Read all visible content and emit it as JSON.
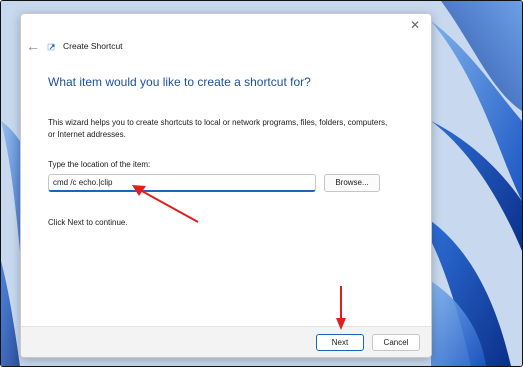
{
  "dialog": {
    "title": "Create Shortcut",
    "close_glyph": "✕",
    "back_glyph": "←",
    "heading": "What item would you like to create a shortcut for?",
    "description": "This wizard helps you to create shortcuts to local or network programs, files, folders, computers, or Internet addresses.",
    "location_label": "Type the location of the item:",
    "location_value": "cmd /c echo.|clip",
    "browse_label": "Browse...",
    "continue_text": "Click Next to continue.",
    "next_label": "Next",
    "cancel_label": "Cancel"
  },
  "icons": {
    "back": "back-arrow-icon",
    "close": "close-icon",
    "app": "shortcut-app-icon"
  },
  "colors": {
    "heading": "#1e4f9c",
    "accent": "#1f64b6",
    "annotation_arrow": "#e0201b",
    "footer_bg": "#f3f3f3"
  }
}
